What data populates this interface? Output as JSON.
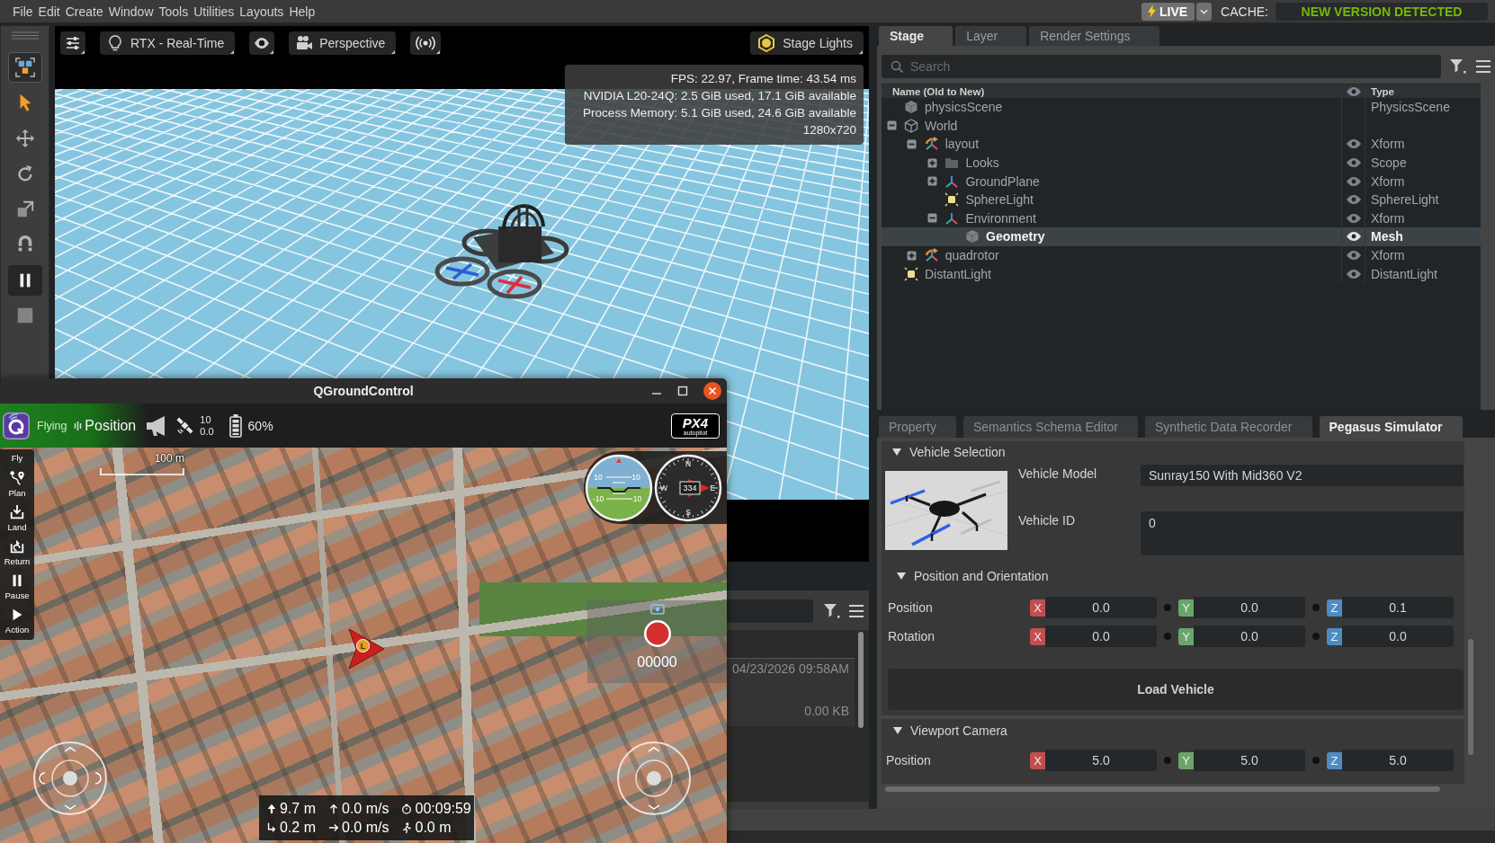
{
  "menu_bar": {
    "items": [
      "File",
      "Edit",
      "Create",
      "Window",
      "Tools",
      "Utilities",
      "Layouts",
      "Help"
    ],
    "live_button": "LIVE",
    "cache_label": "CACHE:",
    "cache_status": "NEW VERSION DETECTED"
  },
  "tool_strip": {
    "tools": [
      {
        "kind": "layout",
        "selected": false
      },
      {
        "kind": "select",
        "selected": true
      },
      {
        "kind": "move",
        "selected": false
      },
      {
        "kind": "rotate",
        "selected": false
      },
      {
        "kind": "scale",
        "selected": false
      },
      {
        "kind": "snap",
        "selected": false
      },
      {
        "kind": "pause",
        "selected": false
      },
      {
        "kind": "stop",
        "selected": false
      }
    ]
  },
  "viewport": {
    "toolbar": [
      {
        "kind": "settings"
      },
      {
        "kind": "renderer",
        "label": "RTX - Real-Time"
      },
      {
        "kind": "display"
      },
      {
        "kind": "camera",
        "label": "Perspective"
      },
      {
        "kind": "streaming"
      }
    ],
    "lights_button": "Stage Lights",
    "stats": [
      "FPS: 22.97, Frame time: 43.54 ms",
      "NVIDIA L20-24Q: 2.5 GiB used, 17.1 GiB available",
      "Process Memory: 5.1 GiB used, 24.6 GiB available",
      "1280x720"
    ]
  },
  "lower_panel": {
    "entry": {
      "date": "04/23/2026 09:58AM",
      "size": "0.00 KB"
    }
  },
  "stage_panel": {
    "tabs": [
      {
        "label": "Stage",
        "selected": true
      },
      {
        "label": "Layer",
        "selected": false
      },
      {
        "label": "Render Settings",
        "selected": false
      }
    ],
    "search": {
      "placeholder": "Search"
    },
    "columns": {
      "name": "Name (Old to New)",
      "type": "Type"
    },
    "tree": [
      {
        "name": "physicsScene",
        "type": "PhysicsScene",
        "kind": "physics",
        "eye_toggle": false,
        "selected": false
      },
      {
        "name": "World",
        "kind": "world",
        "eye_toggle": false,
        "selected": false,
        "expanded": true,
        "children": [
          {
            "name": "layout",
            "type": "Xform",
            "kind": "reference",
            "eye_toggle": true,
            "selected": false,
            "expanded": true,
            "children": [
              {
                "name": "Looks",
                "type": "Scope",
                "kind": "folder",
                "eye_toggle": true,
                "selected": false,
                "expanded": false
              },
              {
                "name": "GroundPlane",
                "type": "Xform",
                "kind": "xform",
                "eye_toggle": true,
                "selected": false,
                "expanded": false
              },
              {
                "name": "SphereLight",
                "type": "SphereLight",
                "kind": "light",
                "eye_toggle": true,
                "selected": false
              },
              {
                "name": "Environment",
                "type": "Xform",
                "kind": "xform",
                "eye_toggle": true,
                "selected": false,
                "expanded": true,
                "children": [
                  {
                    "name": "Geometry",
                    "type": "Mesh",
                    "kind": "mesh",
                    "eye_toggle": true,
                    "selected": true
                  }
                ]
              }
            ]
          },
          {
            "name": "quadrotor",
            "type": "Xform",
            "kind": "reference",
            "eye_toggle": true,
            "selected": false,
            "expanded": false
          }
        ]
      },
      {
        "name": "DistantLight",
        "type": "DistantLight",
        "kind": "light",
        "eye_toggle": true,
        "selected": false
      }
    ]
  },
  "property_panel": {
    "tabs": [
      {
        "label": "Property",
        "selected": false
      },
      {
        "label": "Semantics Schema Editor",
        "selected": false
      },
      {
        "label": "Synthetic Data Recorder",
        "selected": false
      },
      {
        "label": "Pegasus Simulator",
        "selected": true
      }
    ],
    "vehicle_selection": {
      "title": "Vehicle Selection",
      "expanded": true,
      "model_label": "Vehicle Model",
      "model": "Sunray150 With Mid360 V2",
      "id_label": "Vehicle ID",
      "id": "0"
    },
    "position_orientation": {
      "title": "Position and Orientation",
      "expanded": true,
      "rows": [
        {
          "label": "Position",
          "fields": [
            {
              "axis": "X",
              "color": "#c24f4f",
              "value": "0.0"
            },
            {
              "axis": "Y",
              "color": "#6aa66a",
              "value": "0.0"
            },
            {
              "axis": "Z",
              "color": "#4d8cc2",
              "value": "0.1"
            }
          ]
        },
        {
          "label": "Rotation",
          "fields": [
            {
              "axis": "X",
              "color": "#c24f4f",
              "value": "0.0"
            },
            {
              "axis": "Y",
              "color": "#6aa66a",
              "value": "0.0"
            },
            {
              "axis": "Z",
              "color": "#4d8cc2",
              "value": "0.0"
            }
          ]
        }
      ]
    },
    "load_button": "Load Vehicle",
    "viewport_camera": {
      "title": "Viewport Camera",
      "expanded": true,
      "rows": [
        {
          "label": "Position",
          "fields": [
            {
              "axis": "X",
              "color": "#c24f4f",
              "value": "5.0"
            },
            {
              "axis": "Y",
              "color": "#6aa66a",
              "value": "5.0"
            },
            {
              "axis": "Z",
              "color": "#4d8cc2",
              "value": "5.0"
            }
          ]
        }
      ]
    }
  },
  "qgc": {
    "title": "QGroundControl",
    "flight_status": "Flying",
    "flight_mode": "Position",
    "gps": {
      "satellites": "10",
      "hdop": "0.0"
    },
    "battery": "60%",
    "logo": {
      "name": "PX4",
      "tagline": "autopilot"
    },
    "tools": [
      {
        "kind": "fly",
        "label": "Fly"
      },
      {
        "kind": "plan",
        "label": "Plan"
      },
      {
        "kind": "land",
        "label": "Land"
      },
      {
        "kind": "return",
        "label": "Return"
      },
      {
        "kind": "pause",
        "label": "Pause"
      },
      {
        "kind": "action",
        "label": "Action"
      }
    ],
    "scale": "100 m",
    "attitude_labels": [
      "10",
      "10",
      "-10",
      "-10"
    ],
    "compass": {
      "letters": [
        "N",
        "W",
        "E",
        "S"
      ],
      "heading": "334"
    },
    "launch_marker": "L",
    "record_time": "00000",
    "telemetry": [
      {
        "kind": "altitude",
        "value": "9.7 m"
      },
      {
        "kind": "climb_rate",
        "value": "0.0 m/s"
      },
      {
        "kind": "flight_time",
        "value": "00:09:59"
      },
      {
        "kind": "distance",
        "value": "0.2 m"
      },
      {
        "kind": "ground_speed",
        "value": "0.0 m/s"
      },
      {
        "kind": "home_distance",
        "value": "0.0 m"
      }
    ]
  }
}
